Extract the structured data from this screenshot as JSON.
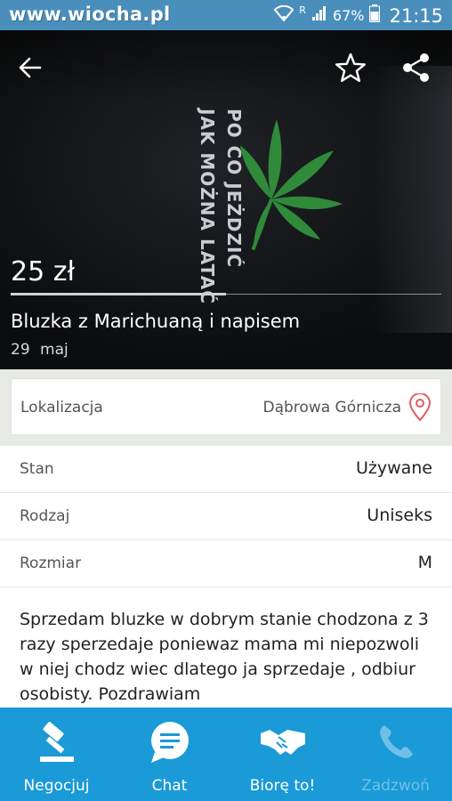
{
  "status_bar": {
    "watermark": "www.wiocha.pl",
    "signal_indicator": "R",
    "battery_percent": "67%",
    "time": "21:15",
    "icons": [
      "wifi-icon",
      "signal-icon",
      "battery-icon"
    ]
  },
  "toolbar": {
    "icons": [
      "back-arrow-icon",
      "star-icon",
      "share-icon"
    ]
  },
  "hero": {
    "shirt_print_line1": "PO CO JEŻDZIĆ",
    "shirt_print_line2": "JAK MOŻNA LATAĆ",
    "price": "25 zł",
    "title": "Bluzka z Marichuaną i napisem",
    "date": "29 maj"
  },
  "location": {
    "label": "Lokalizacja",
    "value": "Dąbrowa Górnicza",
    "icon": "location-pin-icon"
  },
  "attributes": [
    {
      "label": "Stan",
      "value": "Używane"
    },
    {
      "label": "Rodzaj",
      "value": "Uniseks"
    },
    {
      "label": "Rozmiar",
      "value": "M"
    }
  ],
  "description": "Sprzedam bluzke w dobrym stanie chodzona z 3 razy sperzedaje poniewaz mama mi niepozwoli w niej chodz wiec dlatego ja sprzedaje , odbiur osobisty. Pozdrawiam",
  "bottom_bar": {
    "items": [
      {
        "label": "Negocjuj",
        "icon": "gavel-icon",
        "enabled": true
      },
      {
        "label": "Chat",
        "icon": "chat-bubble-icon",
        "enabled": true
      },
      {
        "label": "Biorę to!",
        "icon": "handshake-icon",
        "enabled": true
      },
      {
        "label": "Zadzwoń",
        "icon": "phone-icon",
        "enabled": false
      }
    ]
  },
  "colors": {
    "status_bar": "#4a8fbc",
    "bottom_bar": "#1a9ad6",
    "disabled_label": "#6fc0e8",
    "pin": "#e45b5b",
    "leaf": "#2f8a3a"
  }
}
